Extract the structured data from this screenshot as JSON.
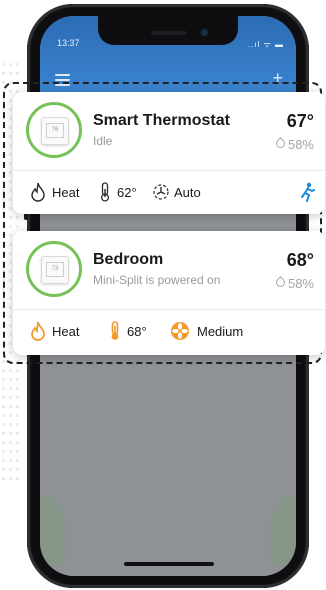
{
  "status_bar": {
    "time": "13:37",
    "signal_icons": "..ıl ᯤ ▬"
  },
  "header": {
    "menu_icon": "hamburger-menu-icon",
    "add_icon": "plus-icon",
    "add_glyph": "+"
  },
  "devices": [
    {
      "name": "Smart Thermostat",
      "status": "Idle",
      "screen_value": "76",
      "temperature": "67°",
      "humidity": "58%",
      "mode": "Heat",
      "setpoint": "62°",
      "fan": "Auto",
      "presence_icon": "person-running-icon"
    },
    {
      "name": "Bedroom",
      "status": "Mini-Split is powered on",
      "screen_value": "73",
      "temperature": "68°",
      "humidity": "58%",
      "mode": "Heat",
      "setpoint": "68°",
      "fan": "Medium"
    }
  ],
  "colors": {
    "accent_green": "#76c158",
    "accent_orange": "#f29a2e",
    "accent_blue": "#1a8ad8",
    "header_blue": "#2b6cb4"
  }
}
